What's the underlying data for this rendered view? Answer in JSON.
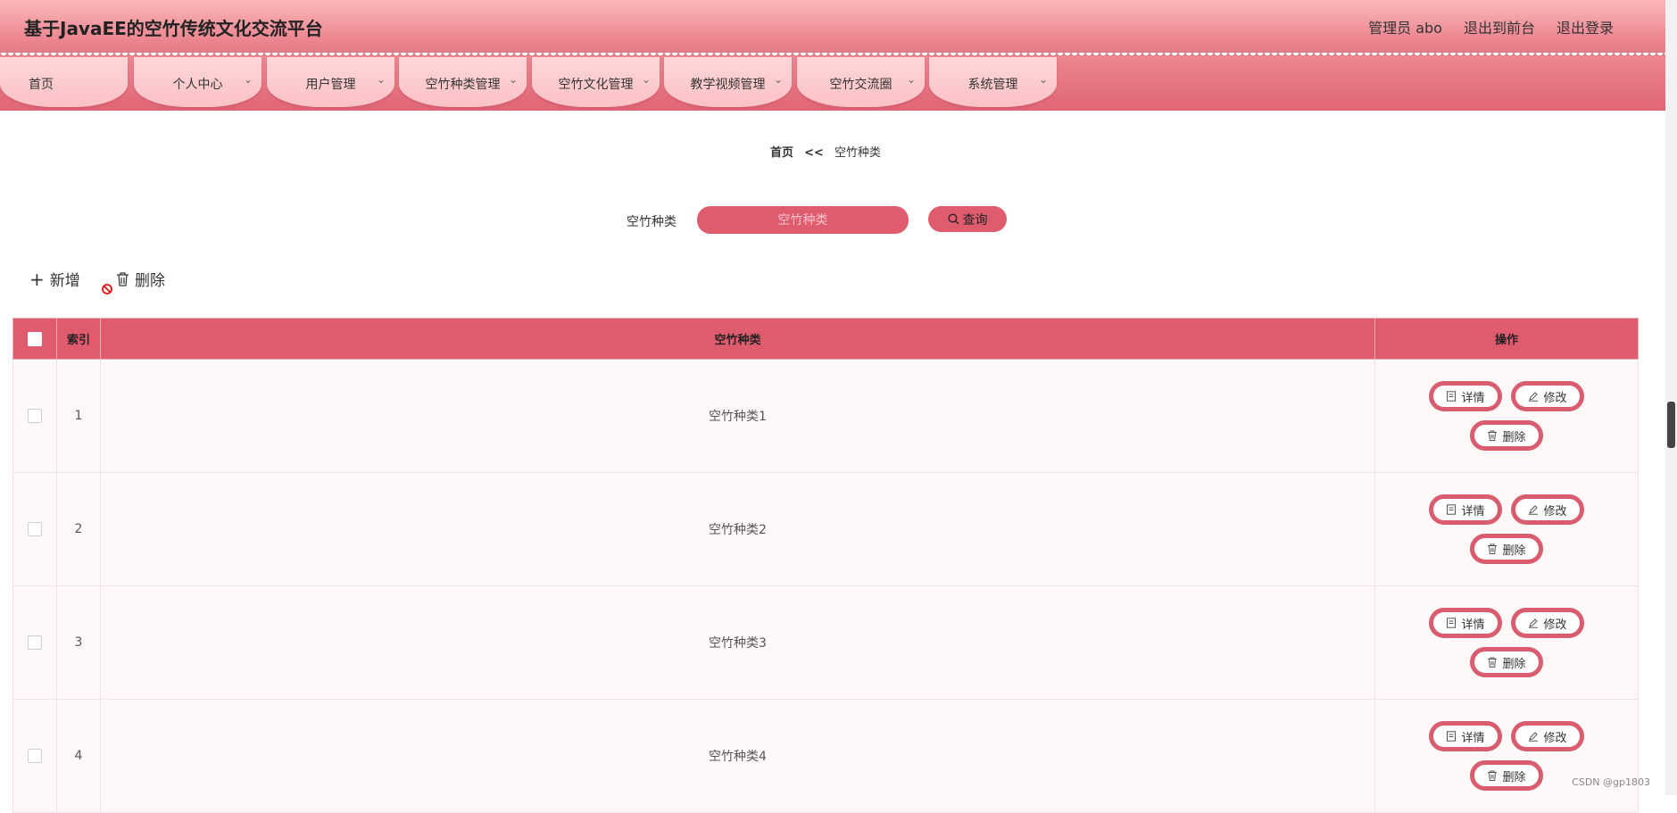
{
  "header": {
    "title": "基于JavaEE的空竹传统文化交流平台",
    "user": "管理员 abo",
    "to_front": "退出到前台",
    "logout": "退出登录"
  },
  "nav": [
    {
      "label": "首页",
      "has_dropdown": false
    },
    {
      "label": "个人中心",
      "has_dropdown": true
    },
    {
      "label": "用户管理",
      "has_dropdown": true
    },
    {
      "label": "空竹种类管理",
      "has_dropdown": true
    },
    {
      "label": "空竹文化管理",
      "has_dropdown": true
    },
    {
      "label": "教学视频管理",
      "has_dropdown": true
    },
    {
      "label": "空竹交流圈",
      "has_dropdown": true
    },
    {
      "label": "系统管理",
      "has_dropdown": true
    }
  ],
  "breadcrumb": {
    "home": "首页",
    "separator": "<<",
    "current": "空竹种类"
  },
  "search": {
    "label": "空竹种类",
    "placeholder": "空竹种类",
    "value": "",
    "button": "查询"
  },
  "actions": {
    "add": "新增",
    "delete": "删除"
  },
  "table": {
    "headers": {
      "index": "索引",
      "category": "空竹种类",
      "ops": "操作"
    },
    "rows": [
      {
        "index": "1",
        "category": "空竹种类1"
      },
      {
        "index": "2",
        "category": "空竹种类2"
      },
      {
        "index": "3",
        "category": "空竹种类3"
      },
      {
        "index": "4",
        "category": "空竹种类4"
      }
    ],
    "row_ops": {
      "detail": "详情",
      "edit": "修改",
      "delete": "删除"
    }
  },
  "watermark": "CSDN @gp1803",
  "colors": {
    "accent": "#df5b6e",
    "header_top": "#fbb7bb",
    "nav_item": "#fbc2c5",
    "row_bg": "#fff8f8"
  }
}
